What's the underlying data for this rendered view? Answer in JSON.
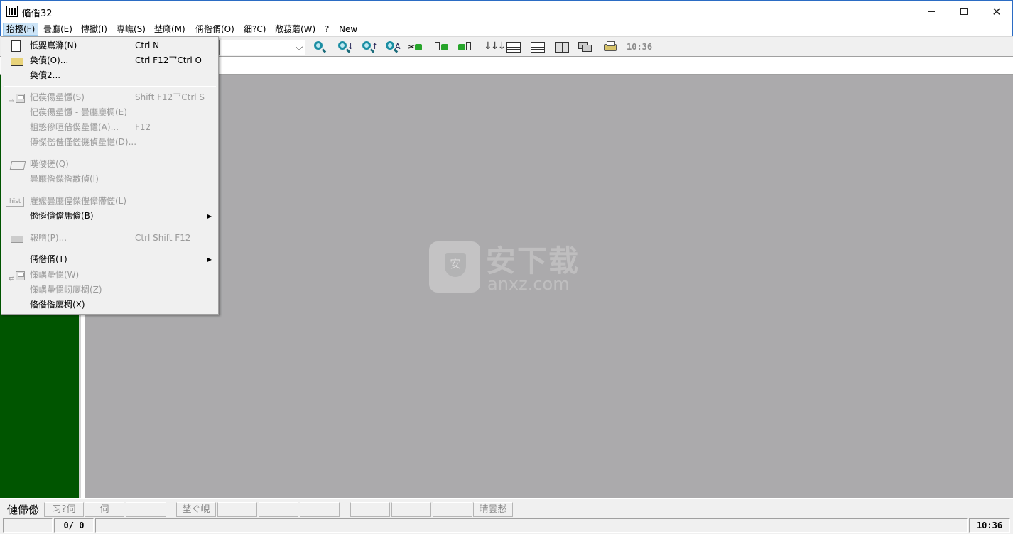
{
  "window": {
    "title": "偹偺32",
    "minimize_glyph": "",
    "close_glyph": "✕"
  },
  "menubar": {
    "items": [
      {
        "label": "抬擾(F)",
        "active": true
      },
      {
        "label": "曇廳(E)"
      },
      {
        "label": "慱擨(I)"
      },
      {
        "label": "専嶕(S)"
      },
      {
        "label": "埜廭(M)"
      },
      {
        "label": "偁偺偦(O)"
      },
      {
        "label": "细?C)"
      },
      {
        "label": "敞菝蘑(W)"
      },
      {
        "label": "?"
      },
      {
        "label": "New"
      }
    ]
  },
  "toolbar": {
    "combo_value": "",
    "clock": "10:36"
  },
  "file_menu": {
    "items": [
      {
        "label": "怟夓嶌滌(N)",
        "shortcut": "Ctrl N",
        "enabled": true,
        "icon": "new-document-icon"
      },
      {
        "label": "奐僨(O)...",
        "shortcut": "Ctrl F12乛Ctrl O",
        "enabled": true,
        "icon": "open-folder-icon"
      },
      {
        "label": "奐僨2...",
        "shortcut": "",
        "enabled": true
      },
      {
        "label": "忋彂偒曐懚(S)",
        "shortcut": "Shift F12乛Ctrl S",
        "enabled": false,
        "icon": "save-icon"
      },
      {
        "label": "忋彂偒曐懚 - 曇廳廮椆(E)",
        "shortcut": "",
        "enabled": false
      },
      {
        "label": "柤慜傪晅偗偰曐懚(A)...",
        "shortcut": "F12",
        "enabled": false
      },
      {
        "label": "僔儏儖僼僅儖僟偵曐懚(D)...",
        "shortcut": "",
        "enabled": false
      },
      {
        "label": "暵偠傞(Q)",
        "shortcut": "",
        "enabled": false,
        "icon": "close-file-icon"
      },
      {
        "label": "曇廳偺偨偺敿偵(I)",
        "shortcut": "",
        "enabled": false
      },
      {
        "label": "嵟嬤曇廳偟偨僼傽僀儖(L)",
        "shortcut": "",
        "enabled": false,
        "icon": "history-icon"
      },
      {
        "label": "僽僢僋儅乕僋(B)",
        "shortcut": "",
        "enabled": true,
        "submenu": true
      },
      {
        "label": "報嶞(P)...",
        "shortcut": "Ctrl Shift F12",
        "enabled": false,
        "icon": "print-icon"
      },
      {
        "label": "偁偺偦(T)",
        "shortcut": "",
        "enabled": true,
        "submenu": true
      },
      {
        "label": "憡嵎曐懚(W)",
        "shortcut": "",
        "enabled": false,
        "icon": "diff-save-icon"
      },
      {
        "label": "憡嵎曐懚屻廮椆(Z)",
        "shortcut": "",
        "enabled": false
      },
      {
        "label": "偹偺偺廔椆(X)",
        "shortcut": "",
        "enabled": true
      }
    ]
  },
  "watermark": {
    "text_cn": "安下载",
    "text_url": "anxz.com",
    "shield_char": "安"
  },
  "bottom_tabs": [
    "僆僀僽",
    "习?伺",
    "伺",
    "",
    "埜ぐ峴",
    "",
    "",
    "",
    "",
    "",
    "",
    "晴曇慭"
  ],
  "statusbar": {
    "counter": "0/ 0",
    "clock": "10:36"
  },
  "colors": {
    "left_panel": "#005500",
    "workspace": "#abaaac",
    "menu_highlight": "#cce4f7"
  }
}
